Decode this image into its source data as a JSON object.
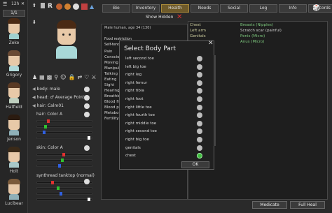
{
  "top_left": {
    "time_label": "12h",
    "mode_label": "1/1"
  },
  "colonists": [
    {
      "name": "Zeke",
      "hair": "#4a2a14",
      "shirt": "#9fd0d0"
    },
    {
      "name": "Grigory",
      "hair": "#6a4a34",
      "shirt": "#b0d8d8"
    },
    {
      "name": "Hatfield",
      "hair": "#5a3a24",
      "shirt": "#c0d0c0"
    },
    {
      "name": "Jenson",
      "hair": "#2b1b10",
      "shirt": "#8fb0b8"
    },
    {
      "name": "Holt",
      "hair": "#3a2a18",
      "shirt": "#a8c8c8"
    },
    {
      "name": "Lucibear",
      "hair": "#7a5a3a",
      "shirt": "#8fb0b8"
    }
  ],
  "tabs": [
    "Bio",
    "Inventory",
    "Health",
    "Needs",
    "Social",
    "Log",
    "Info",
    "Records"
  ],
  "active_tab": "Health",
  "show_hidden_label": "Show Hidden",
  "top_icons": {
    "r": "R"
  },
  "editor": {
    "body_label": "body: male",
    "head_label": "head: ♂ Average Pointy",
    "hair_label": "hair: Calm01",
    "hair_color_label": "hair: Color A",
    "skin_label": "skin: Color A",
    "apparel_label": "synthread tanktop (normal)"
  },
  "health_header": {
    "subtitle": "Male human, age 34 (130)",
    "food_label": "Food restriction",
    "self_tend_label": "Self-tend"
  },
  "capacities": [
    "Pain",
    "Conscious",
    "Moving",
    "Manipul",
    "Talking",
    "Eating",
    "Sight",
    "Hearing",
    "Breathing",
    "Blood fil",
    "Blood pu",
    "Metabol",
    "Fertility"
  ],
  "hediffs": [
    {
      "part": "Chest",
      "text": "Breasts (Nipples)",
      "green": true
    },
    {
      "part": "Left arm",
      "text": "Scratch scar (painful)",
      "green": false
    },
    {
      "part": "Genitals",
      "text": "Penis (Micro)",
      "green": true
    },
    {
      "part": "",
      "text": "Anus (Micro)",
      "green": true
    }
  ],
  "modal": {
    "title": "Select Body Part",
    "close_icon": "✕",
    "items": [
      "left second toe",
      "left big toe",
      "right leg",
      "right femur",
      "right tibia",
      "right foot",
      "right little toe",
      "right fourth toe",
      "right middle toe",
      "right second toe",
      "right big toe",
      "genitals",
      "chest"
    ],
    "selected": "chest",
    "ok_label": "OK"
  },
  "bottom_buttons": {
    "medicate": "Medicate",
    "full_heal": "Full Heal"
  }
}
